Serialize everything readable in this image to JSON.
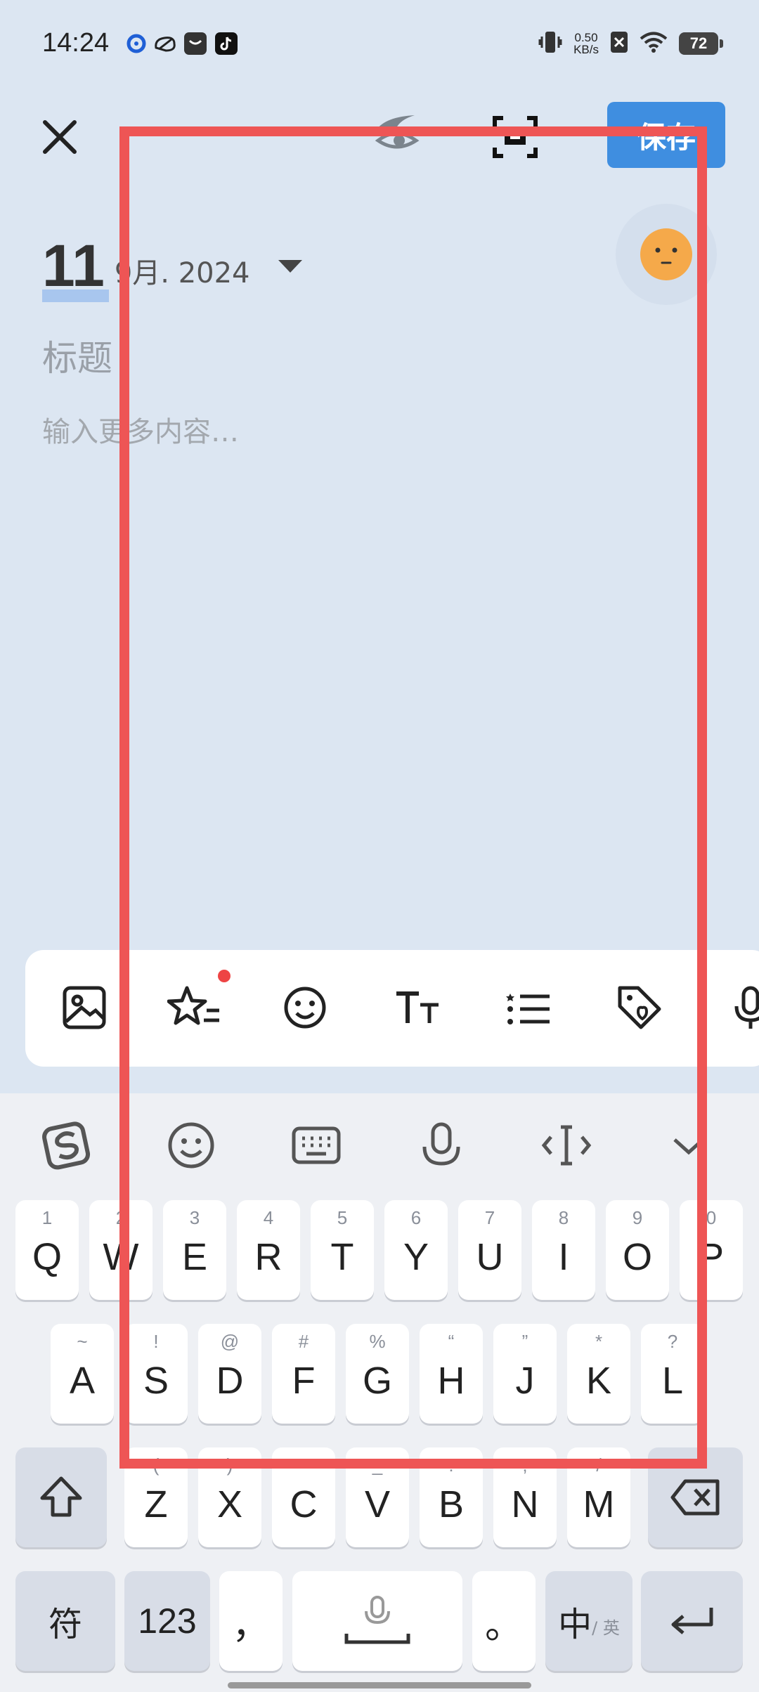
{
  "status_bar": {
    "time": "14:24",
    "net_speed_value": "0.50",
    "net_speed_unit": "KB/s",
    "battery": "72"
  },
  "header": {
    "save_label": "保存"
  },
  "entry": {
    "day": "11",
    "month_year": "9月. 2024",
    "title_placeholder": "标题",
    "content_placeholder": "输入更多内容…"
  },
  "keyboard": {
    "row1": [
      {
        "key": "Q",
        "sub": "1"
      },
      {
        "key": "W",
        "sub": "2"
      },
      {
        "key": "E",
        "sub": "3"
      },
      {
        "key": "R",
        "sub": "4"
      },
      {
        "key": "T",
        "sub": "5"
      },
      {
        "key": "Y",
        "sub": "6"
      },
      {
        "key": "U",
        "sub": "7"
      },
      {
        "key": "I",
        "sub": "8"
      },
      {
        "key": "O",
        "sub": "9"
      },
      {
        "key": "P",
        "sub": "0"
      }
    ],
    "row2": [
      {
        "key": "A",
        "sub": "~"
      },
      {
        "key": "S",
        "sub": "!"
      },
      {
        "key": "D",
        "sub": "@"
      },
      {
        "key": "F",
        "sub": "#"
      },
      {
        "key": "G",
        "sub": "%"
      },
      {
        "key": "H",
        "sub": "“"
      },
      {
        "key": "J",
        "sub": "”"
      },
      {
        "key": "K",
        "sub": "*"
      },
      {
        "key": "L",
        "sub": "?"
      }
    ],
    "row3": [
      {
        "key": "Z",
        "sub": "("
      },
      {
        "key": "X",
        "sub": ")"
      },
      {
        "key": "C",
        "sub": "-"
      },
      {
        "key": "V",
        "sub": "_"
      },
      {
        "key": "B",
        "sub": ":"
      },
      {
        "key": "N",
        "sub": ";"
      },
      {
        "key": "M",
        "sub": "/"
      }
    ],
    "symbol_label": "符",
    "numbers_label": "123",
    "comma": "，",
    "period": "。",
    "lang_main": "中",
    "lang_sub": "/ 英"
  },
  "colors": {
    "background": "#dce6f2",
    "save_button": "#3f8ee0",
    "mood_face": "#f5a94a",
    "annotation_rect": "#ee5555",
    "notification_dot": "#ee4444"
  },
  "icons": {
    "header": [
      "close-icon",
      "eye-icon",
      "scan-icon"
    ],
    "format_bar": [
      "image-icon",
      "star-list-icon",
      "emoji-icon",
      "text-size-icon",
      "checklist-icon",
      "tag-icon",
      "microphone-icon"
    ],
    "keyboard_toolbar": [
      "sogou-logo-icon",
      "emoji-icon",
      "keyboard-icon",
      "microphone-icon",
      "cursor-icon",
      "collapse-icon"
    ]
  }
}
